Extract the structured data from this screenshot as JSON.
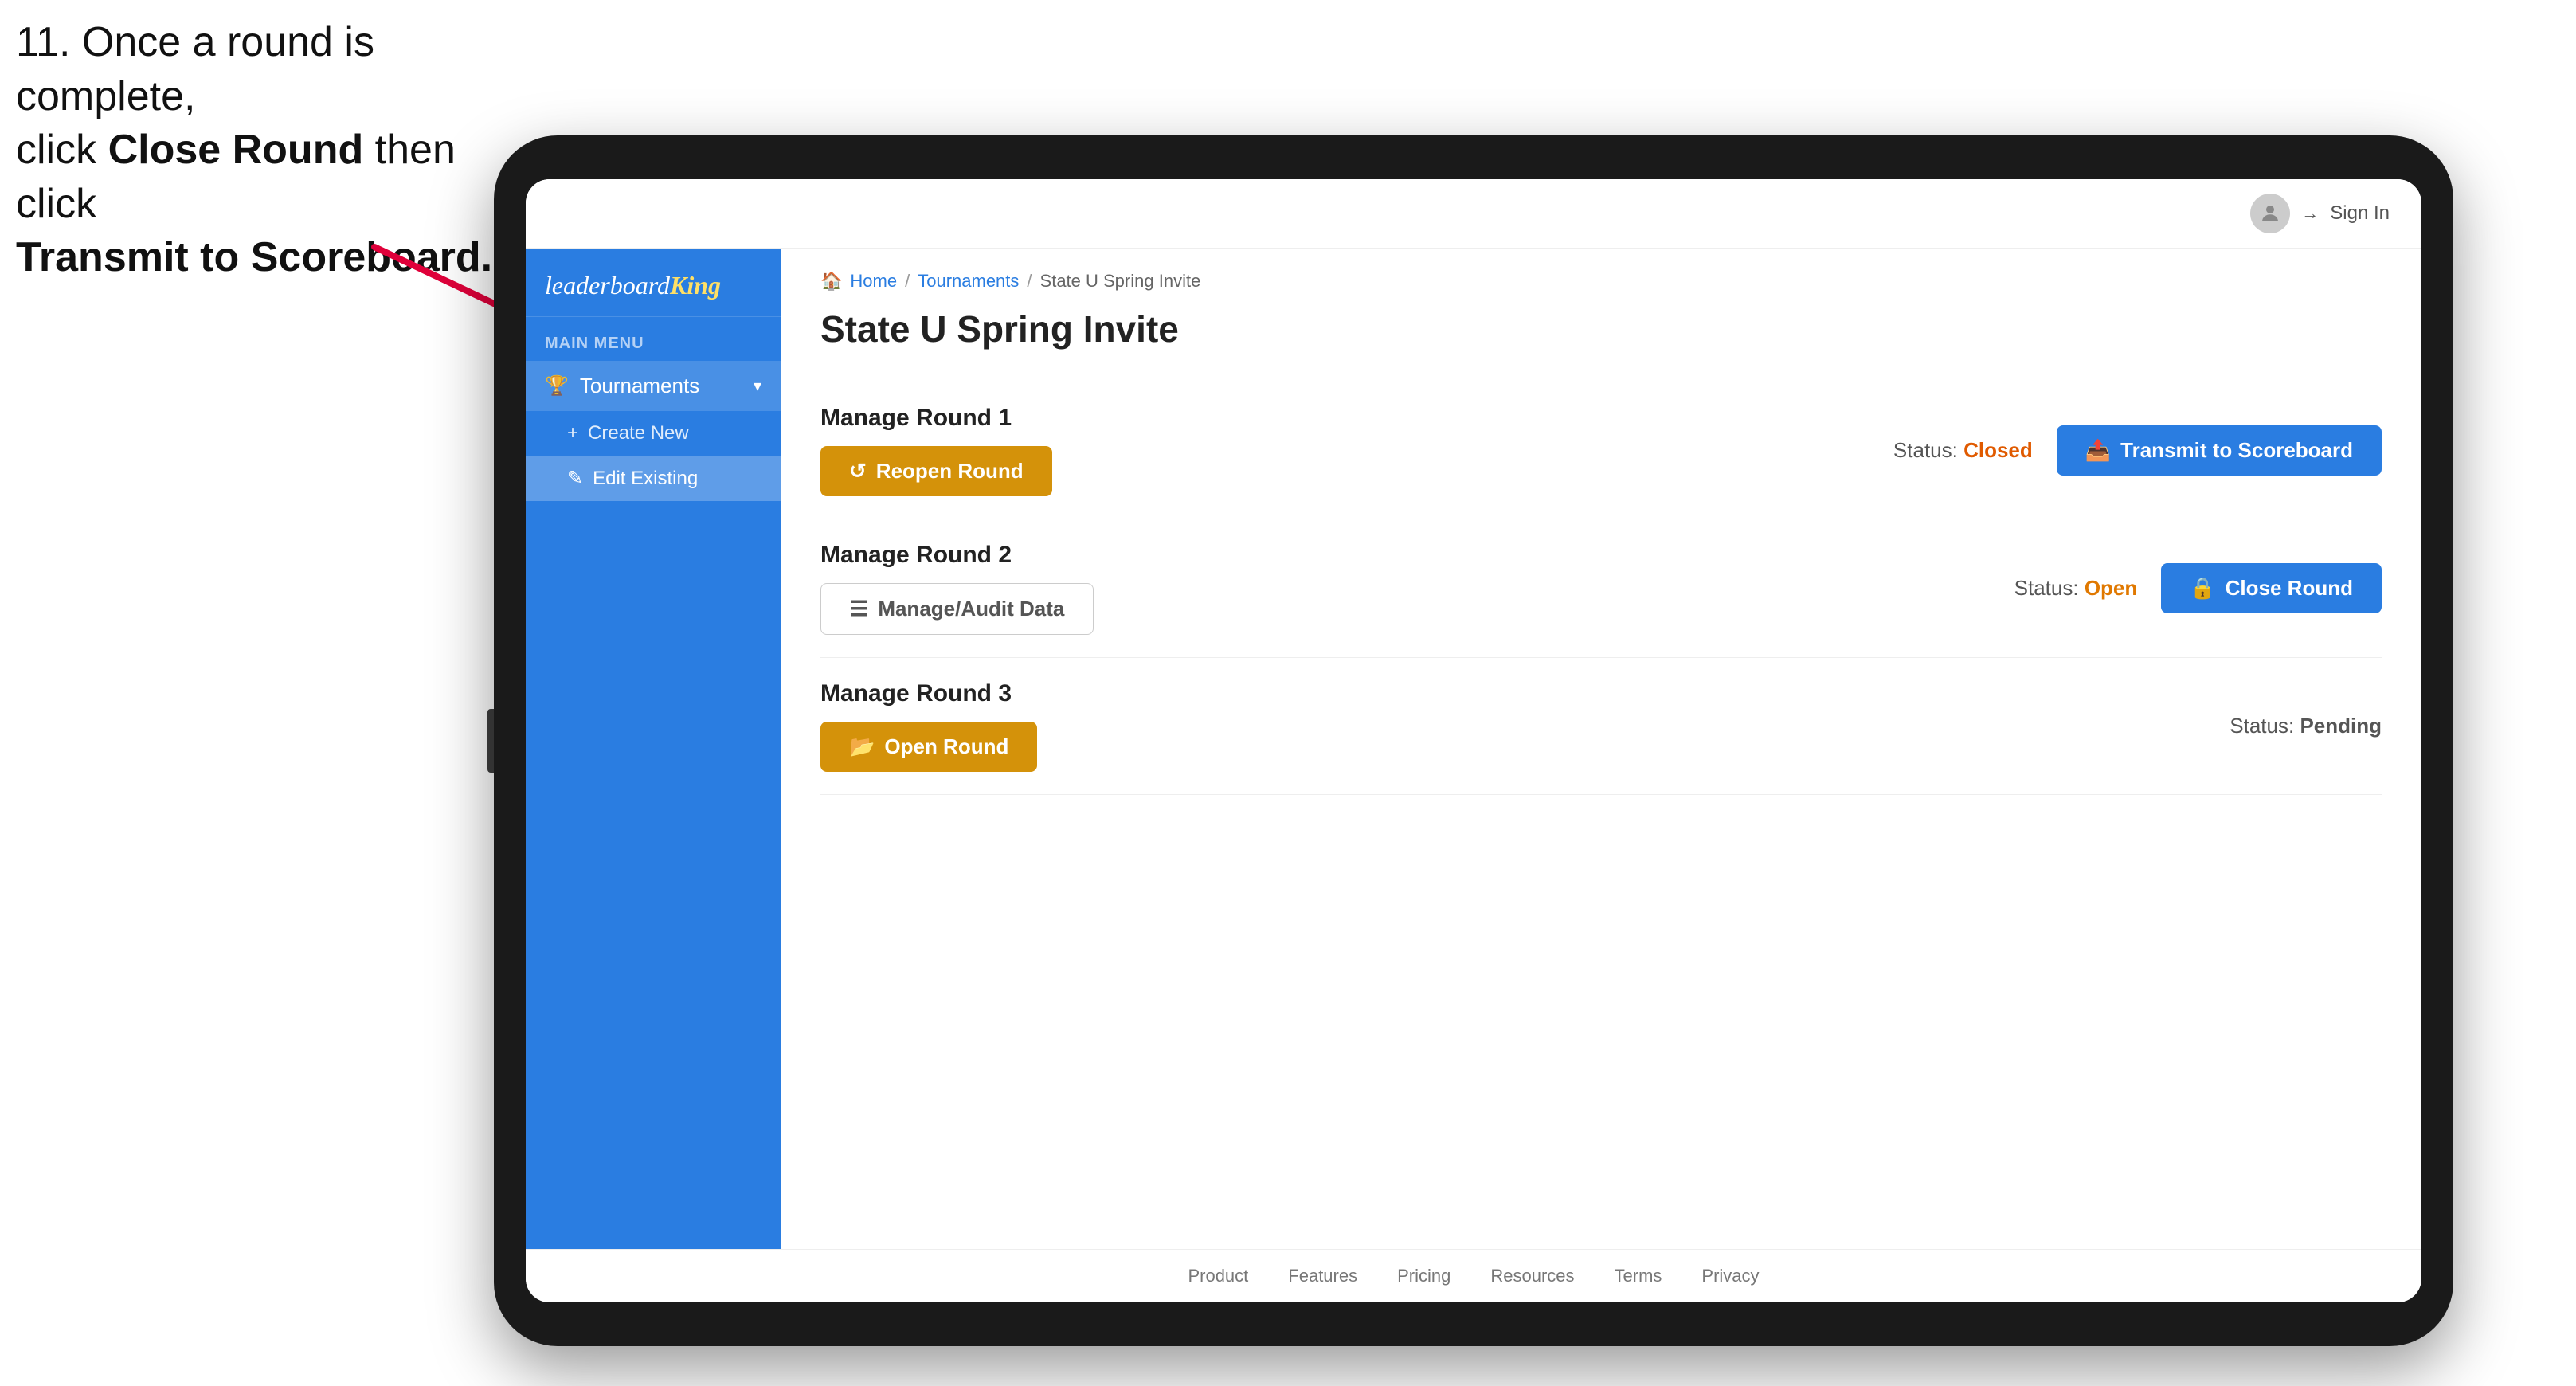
{
  "instruction": {
    "line1": "11. Once a round is complete,",
    "line2": "click ",
    "bold1": "Close Round",
    "line3": " then click",
    "bold2": "Transmit to Scoreboard."
  },
  "topbar": {
    "sign_in_label": "Sign In"
  },
  "sidebar": {
    "logo": "leaderboard",
    "logo_king": "King",
    "main_menu_label": "MAIN MENU",
    "tournaments_label": "Tournaments",
    "create_new_label": "Create New",
    "edit_existing_label": "Edit Existing"
  },
  "breadcrumb": {
    "home": "Home",
    "sep1": "/",
    "tournaments": "Tournaments",
    "sep2": "/",
    "current": "State U Spring Invite"
  },
  "page": {
    "title": "State U Spring Invite"
  },
  "rounds": [
    {
      "id": "round1",
      "title": "Manage Round 1",
      "status_label": "Status:",
      "status_value": "Closed",
      "status_class": "closed",
      "button1_label": "Reopen Round",
      "button1_type": "gold",
      "button2_label": "Transmit to Scoreboard",
      "button2_type": "blue"
    },
    {
      "id": "round2",
      "title": "Manage Round 2",
      "status_label": "Status:",
      "status_value": "Open",
      "status_class": "open",
      "button1_label": "Manage/Audit Data",
      "button1_type": "outline",
      "button2_label": "Close Round",
      "button2_type": "blue"
    },
    {
      "id": "round3",
      "title": "Manage Round 3",
      "status_label": "Status:",
      "status_value": "Pending",
      "status_class": "pending",
      "button1_label": "Open Round",
      "button1_type": "gold",
      "button2_label": "",
      "button2_type": ""
    }
  ],
  "footer": {
    "links": [
      "Product",
      "Features",
      "Pricing",
      "Resources",
      "Terms",
      "Privacy"
    ]
  }
}
